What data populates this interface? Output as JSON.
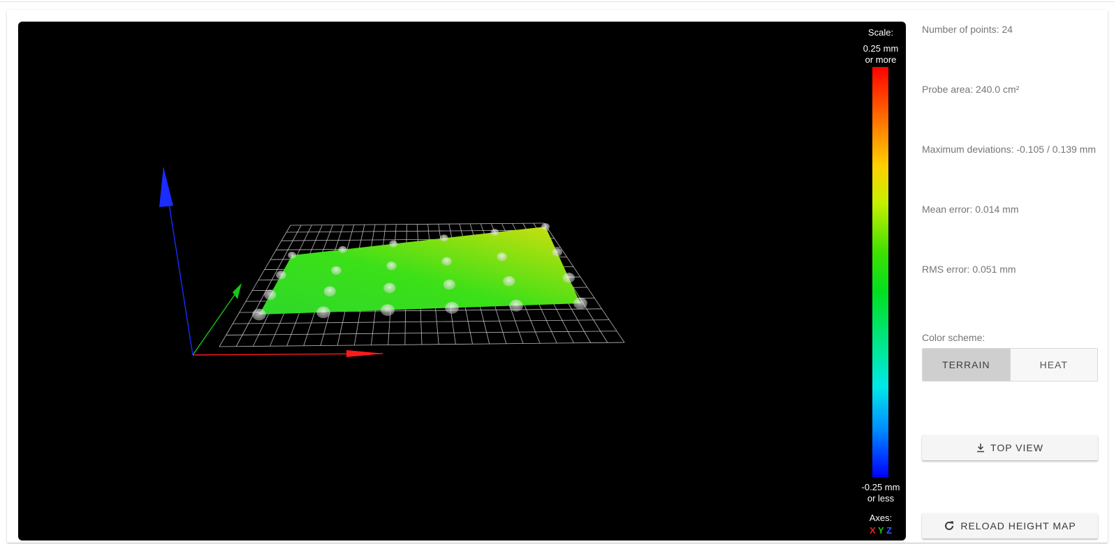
{
  "viewer": {
    "scale_title": "Scale:",
    "scale_max_line1": "0.25 mm",
    "scale_max_line2": "or more",
    "scale_min_line1": "-0.25 mm",
    "scale_min_line2": "or less",
    "axes_title": "Axes:",
    "axes": {
      "x": "X",
      "y": "Y",
      "z": "Z"
    },
    "colors": {
      "x_axis": "#ff1a1a",
      "y_axis": "#18c618",
      "z_axis": "#2a5cff",
      "background": "#000000"
    }
  },
  "stats": {
    "points": "Number of points: 24",
    "area": "Probe area: 240.0 cm²",
    "deviations": "Maximum deviations: -0.105 / 0.139 mm",
    "mean": "Mean error: 0.014 mm",
    "rms": "RMS error: 0.051 mm"
  },
  "color_scheme": {
    "label": "Color scheme:",
    "options": [
      "TERRAIN",
      "HEAT"
    ],
    "selected": "TERRAIN"
  },
  "buttons": {
    "top_view": {
      "label": "TOP VIEW",
      "icon": "arrow-collapse-down-icon"
    },
    "reload": {
      "label": "RELOAD HEIGHT MAP",
      "icon": "refresh-icon"
    }
  }
}
